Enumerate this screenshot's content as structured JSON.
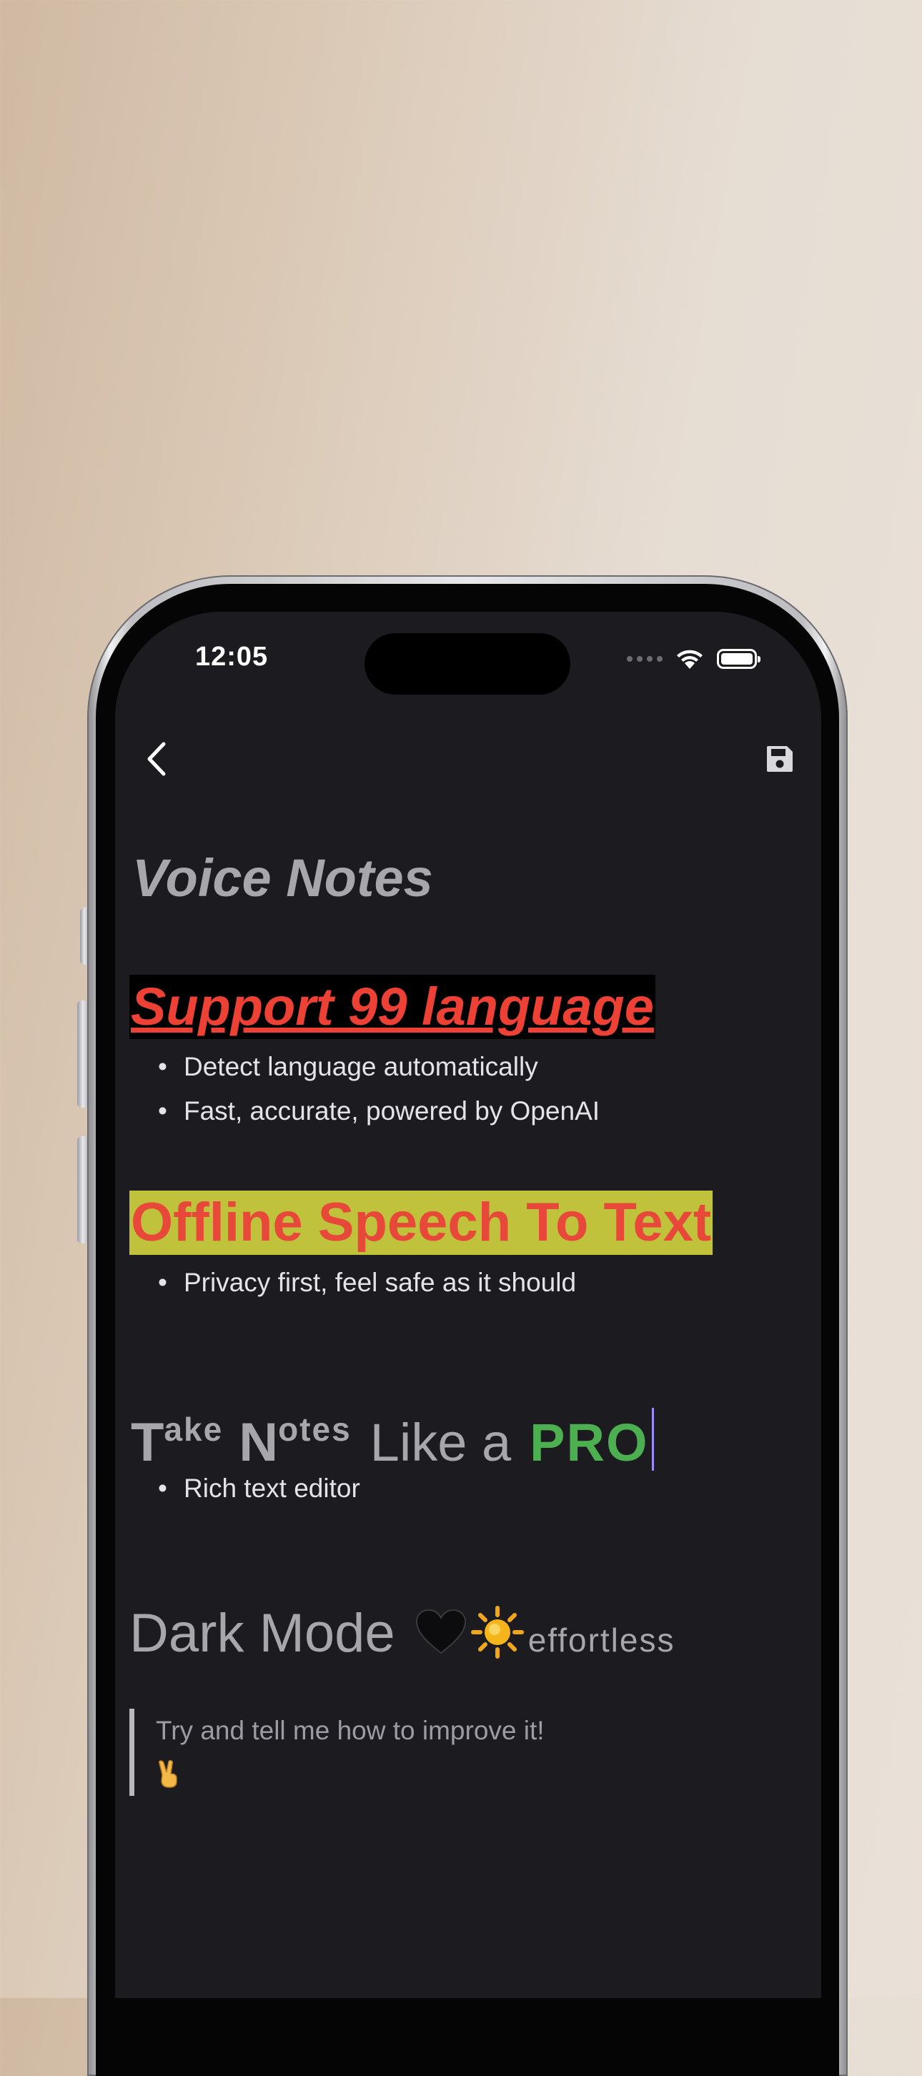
{
  "status_bar": {
    "time": "12:05"
  },
  "nav": {
    "back_icon": "chevron-left-icon",
    "save_icon": "floppy-disk-icon"
  },
  "note": {
    "title": "Voice Notes",
    "sections": [
      {
        "heading": "Support 99 language",
        "heading_color": "#ee4135",
        "heading_background": "#000000",
        "bullets": [
          "Detect language automatically",
          "Fast, accurate, powered by OpenAI"
        ]
      },
      {
        "heading": "Offline Speech To Text",
        "heading_color": "#e8483a",
        "heading_background": "#bfc23a",
        "bullets": [
          "Privacy first, feel safe as it should"
        ]
      },
      {
        "heading_parts": {
          "t": "T",
          "ake": "ake",
          "n": "N",
          "otes": "otes",
          "like_a": "Like a",
          "pro": "PRO"
        },
        "pro_color": "#4caf50",
        "bullets": [
          "Rich text editor"
        ]
      },
      {
        "heading_parts": {
          "dark_mode": "Dark Mode",
          "effortless": "effortless"
        },
        "emojis": [
          "black-heart-icon",
          "sun-icon"
        ]
      }
    ],
    "quote": {
      "text": "Try and tell me how to improve it!",
      "emoji": "victory-hand-icon"
    }
  }
}
